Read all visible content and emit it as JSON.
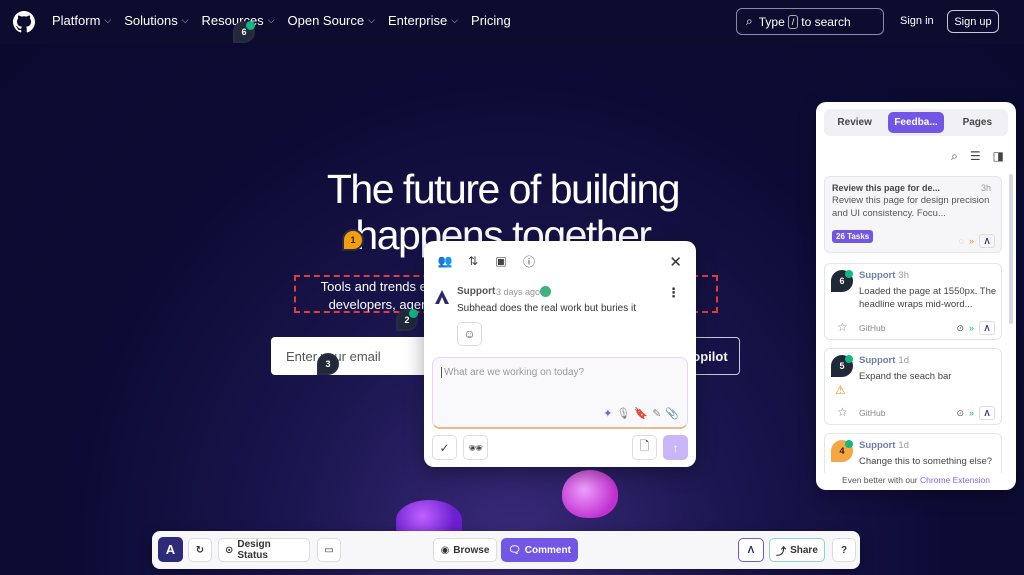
{
  "nav": {
    "items": [
      {
        "label": "Platform",
        "chevron": true
      },
      {
        "label": "Solutions",
        "chevron": true
      },
      {
        "label": "Resources",
        "chevron": true
      },
      {
        "label": "Open Source",
        "chevron": true
      },
      {
        "label": "Enterprise",
        "chevron": true
      },
      {
        "label": "Pricing",
        "chevron": false
      }
    ],
    "search_prefix": "Type",
    "search_key": "/",
    "search_suffix": "to search",
    "signin": "Sign in",
    "signup": "Sign up"
  },
  "hero": {
    "title_line1": "The future of building",
    "title_line2": "happens together",
    "subtitle_line1": "Tools and trends evolve, but collaboration endures. With GitHub,",
    "subtitle_line2": "developers, agents, and code come together on one platform.",
    "email_placeholder": "Enter your email",
    "cta_suffix": "opilot"
  },
  "pins": [
    {
      "number": "6",
      "style": "dark"
    },
    {
      "number": "1",
      "style": "orange"
    },
    {
      "number": "2",
      "style": "dark"
    },
    {
      "number": "3",
      "style": "dark"
    }
  ],
  "popup": {
    "author": "Support",
    "time": "3 days ago",
    "body": "Subhead does the real work but buries it",
    "reply_placeholder": "What are we working on today?"
  },
  "panel": {
    "tabs": [
      "Review",
      "Feedba...",
      "Pages"
    ],
    "active_tab": 1,
    "summary": {
      "title": "Review this page for de...",
      "age": "3h",
      "text": "Review this page for design precision and UI consistency. Focu...",
      "tasks": "26 Tasks"
    },
    "cards": [
      {
        "pin": "6",
        "style": "dark",
        "author": "Support",
        "time": "3h",
        "body": "Loaded the page at 1550px. The headline wraps mid-word...",
        "source": "GitHub"
      },
      {
        "pin": "5",
        "style": "dark",
        "author": "Support",
        "time": "1d",
        "body": "Expand the seach bar",
        "source": "GitHub"
      },
      {
        "pin": "4",
        "style": "orange",
        "author": "Support",
        "time": "1d",
        "body": "Change this to something else?",
        "source": ""
      }
    ],
    "footer_prefix": "Even better with our",
    "footer_link": "Chrome Extension"
  },
  "toolbar": {
    "logo": "A",
    "design_status": "Design Status",
    "browse": "Browse",
    "comment": "Comment",
    "share": "Share"
  }
}
